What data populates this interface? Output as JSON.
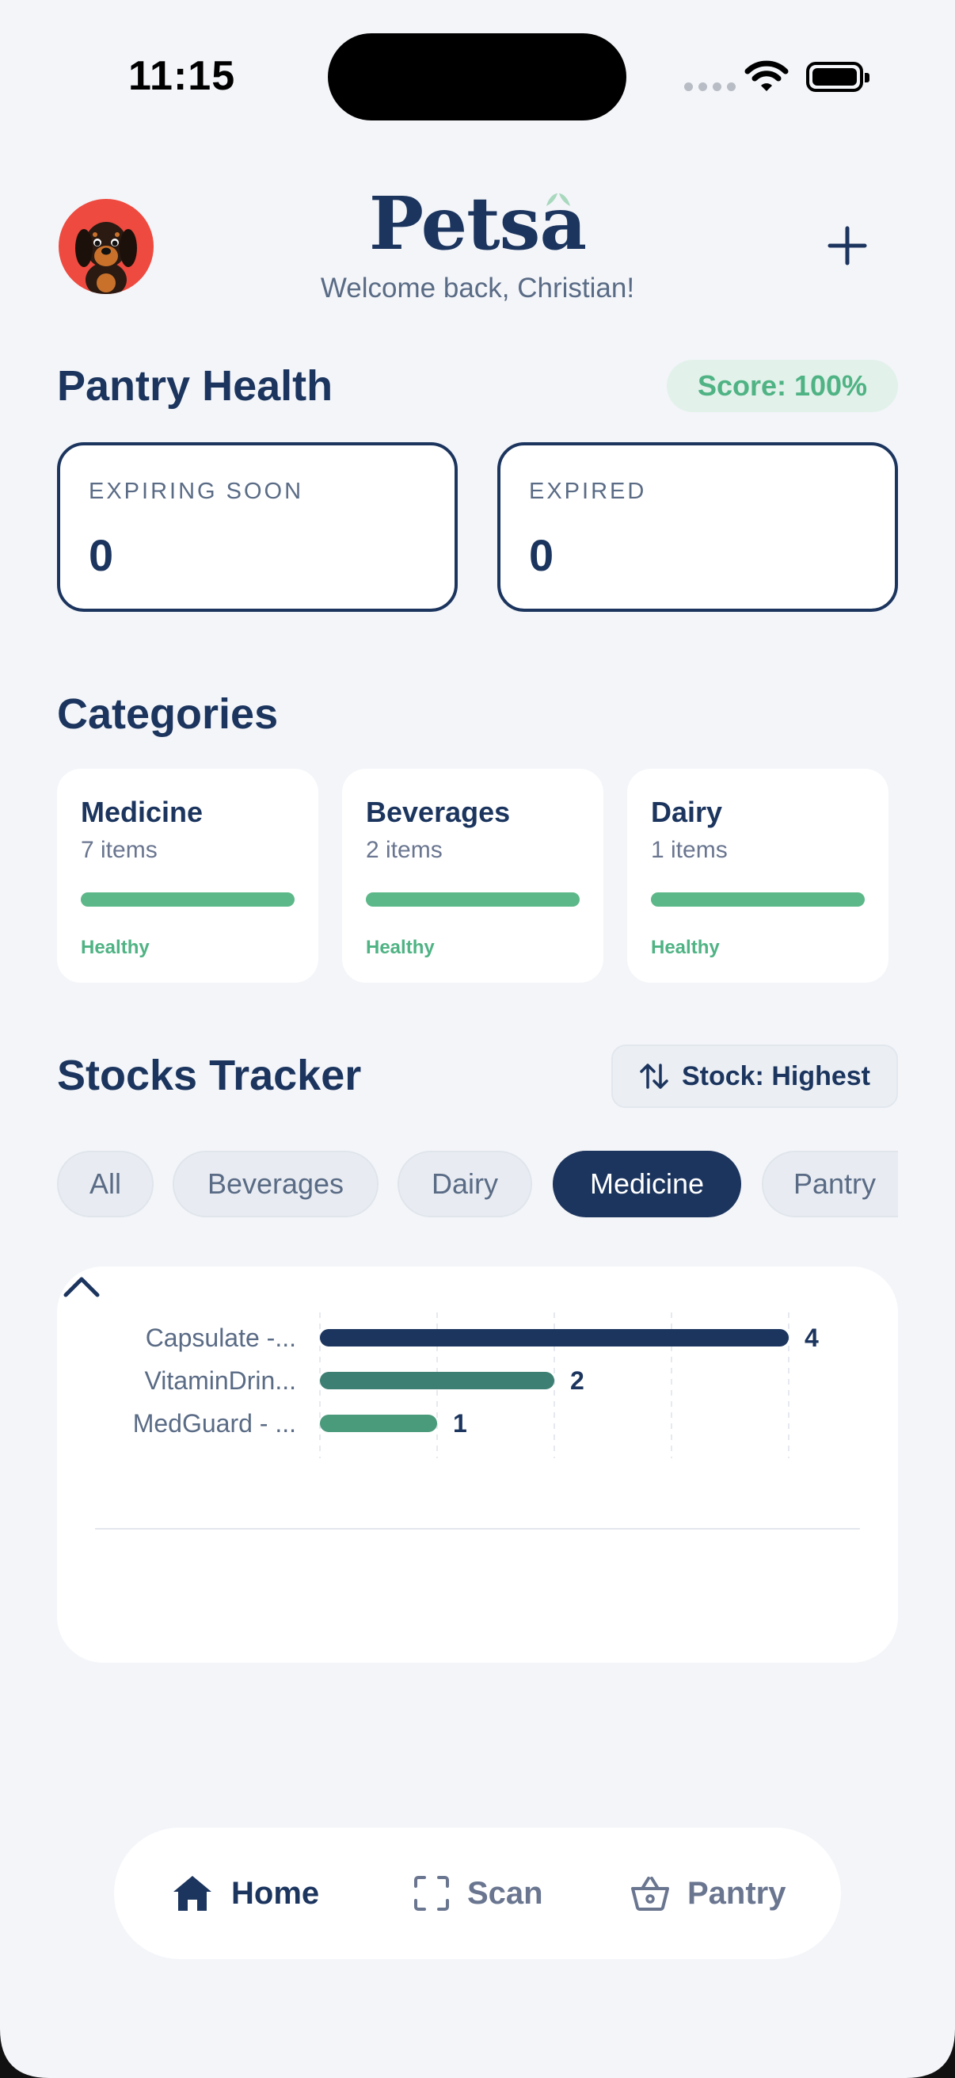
{
  "status_bar": {
    "time": "11:15"
  },
  "header": {
    "app_name": "Petsa",
    "welcome": "Welcome back, Christian!",
    "avatar_icon": "dachshund-avatar-icon",
    "add_icon": "plus-icon"
  },
  "pantry_health": {
    "title": "Pantry Health",
    "score": "Score: 100%",
    "cards": [
      {
        "label": "EXPIRING SOON",
        "value": "0"
      },
      {
        "label": "EXPIRED",
        "value": "0"
      }
    ]
  },
  "categories": {
    "title": "Categories",
    "items": [
      {
        "name": "Medicine",
        "count": "7 items",
        "status": "Healthy",
        "health": 1.0
      },
      {
        "name": "Beverages",
        "count": "2 items",
        "status": "Healthy",
        "health": 1.0
      },
      {
        "name": "Dairy",
        "count": "1 items",
        "status": "Healthy",
        "health": 1.0
      }
    ]
  },
  "stocks_tracker": {
    "title": "Stocks Tracker",
    "sort_label": "Stock: Highest",
    "filters": [
      "All",
      "Beverages",
      "Dairy",
      "Medicine",
      "Pantry"
    ],
    "active_filter": "Medicine"
  },
  "chart_data": {
    "type": "bar",
    "orientation": "horizontal",
    "categories": [
      "Capsulate -...",
      "VitaminDrin...",
      "MedGuard - ..."
    ],
    "values": [
      4,
      2,
      1
    ],
    "colors": [
      "#1c355e",
      "#3d7f72",
      "#4a9a7c"
    ],
    "xlim": [
      0,
      4
    ],
    "grid": true
  },
  "nav": {
    "items": [
      {
        "label": "Home",
        "icon": "home-icon",
        "active": true
      },
      {
        "label": "Scan",
        "icon": "scan-icon",
        "active": false
      },
      {
        "label": "Pantry",
        "icon": "basket-icon",
        "active": false
      }
    ]
  },
  "colors": {
    "primary": "#1c355e",
    "healthy": "#5cb888",
    "background": "#f3f5f9",
    "avatar_bg": "#ee4a3f"
  }
}
